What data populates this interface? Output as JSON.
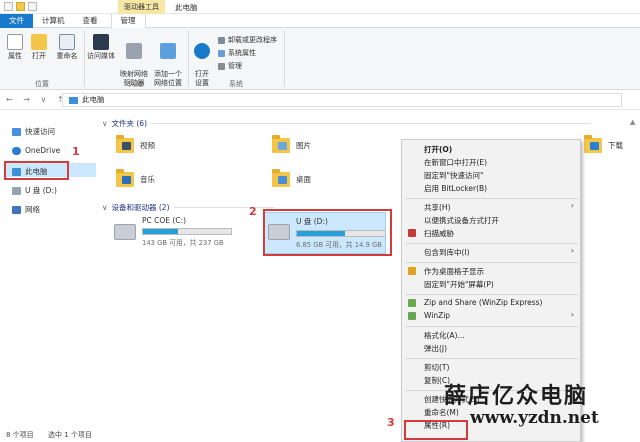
{
  "title_bar": {
    "context_tools": "驱动器工具",
    "window_title": "此电脑"
  },
  "tabs": [
    "文件",
    "计算机",
    "查看",
    "管理"
  ],
  "ribbon": {
    "location_buttons": [
      "属性",
      "打开",
      "重命名"
    ],
    "location_group": "位置",
    "network_buttons": [
      "访问媒体",
      "映射网络\n驱动器",
      "添加一个\n网络位置"
    ],
    "network_group": "网络",
    "system_open": "打开\n设置",
    "system_items": [
      "卸载或更改程序",
      "系统属性",
      "管理"
    ],
    "system_group": "系统"
  },
  "address": {
    "path": "此电脑",
    "nav": "← → ∨ ↑"
  },
  "sidebar": {
    "items": [
      "快速访问",
      "OneDrive",
      "此电脑",
      "U 盘 (D:)",
      "网络"
    ]
  },
  "content": {
    "folders_header": "文件夹 (6)",
    "folders": [
      {
        "name": "视频",
        "icon": "video-folder-icon"
      },
      {
        "name": "图片",
        "icon": "pictures-folder-icon"
      },
      {
        "name": "音乐",
        "icon": "music-folder-icon"
      },
      {
        "name": "桌面",
        "icon": "desktop-folder-icon"
      },
      {
        "name": "下载",
        "icon": "download-folder-icon"
      }
    ],
    "drives_header": "设备和驱动器 (2)",
    "drives": [
      {
        "name": "PC COE (C:)",
        "detail": "143 GB 可用，共 237 GB",
        "used_fraction": 0.4
      },
      {
        "name": "U 盘 (D:)",
        "detail": "6.85 GB 可用，共 14.9 GB",
        "used_fraction": 0.54
      }
    ]
  },
  "context_menu": {
    "items": [
      {
        "label": "打开(O)",
        "bold": true
      },
      {
        "label": "在新窗口中打开(E)"
      },
      {
        "label": "固定到\"快速访问\""
      },
      {
        "label": "启用 BitLocker(B)"
      },
      {
        "label": "共享(H)",
        "submenu": true
      },
      {
        "label": "以便携式设备方式打开"
      },
      {
        "label": "扫描威胁",
        "icon": "defender-icon"
      },
      {
        "label": "包含到库中(I)",
        "submenu": true
      },
      {
        "label": "作为桌面格子显示",
        "icon": "fences-icon"
      },
      {
        "label": "固定到\"开始\"屏幕(P)"
      },
      {
        "label": "Zip and Share (WinZip Express)",
        "icon": "winzip-icon"
      },
      {
        "label": "WinZip",
        "icon": "winzip-icon",
        "submenu": true
      },
      {
        "label": "格式化(A)..."
      },
      {
        "label": "弹出(J)"
      },
      {
        "label": "剪切(T)"
      },
      {
        "label": "复制(C)"
      },
      {
        "label": "创建快捷方式(S)"
      },
      {
        "label": "重命名(M)"
      },
      {
        "label": "属性(R)"
      }
    ]
  },
  "annotations": [
    "1",
    "2",
    "3"
  ],
  "status": {
    "count": "8 个项目",
    "selected": "选中 1 个项目"
  },
  "watermark": {
    "line1": "薛店亿众电脑",
    "line2": "www.yzdn.net"
  },
  "colors": {
    "accent": "#1979ca",
    "selection": "#cce8ff",
    "annotation": "#d43b3b",
    "drive_bar": "#26a0da"
  }
}
